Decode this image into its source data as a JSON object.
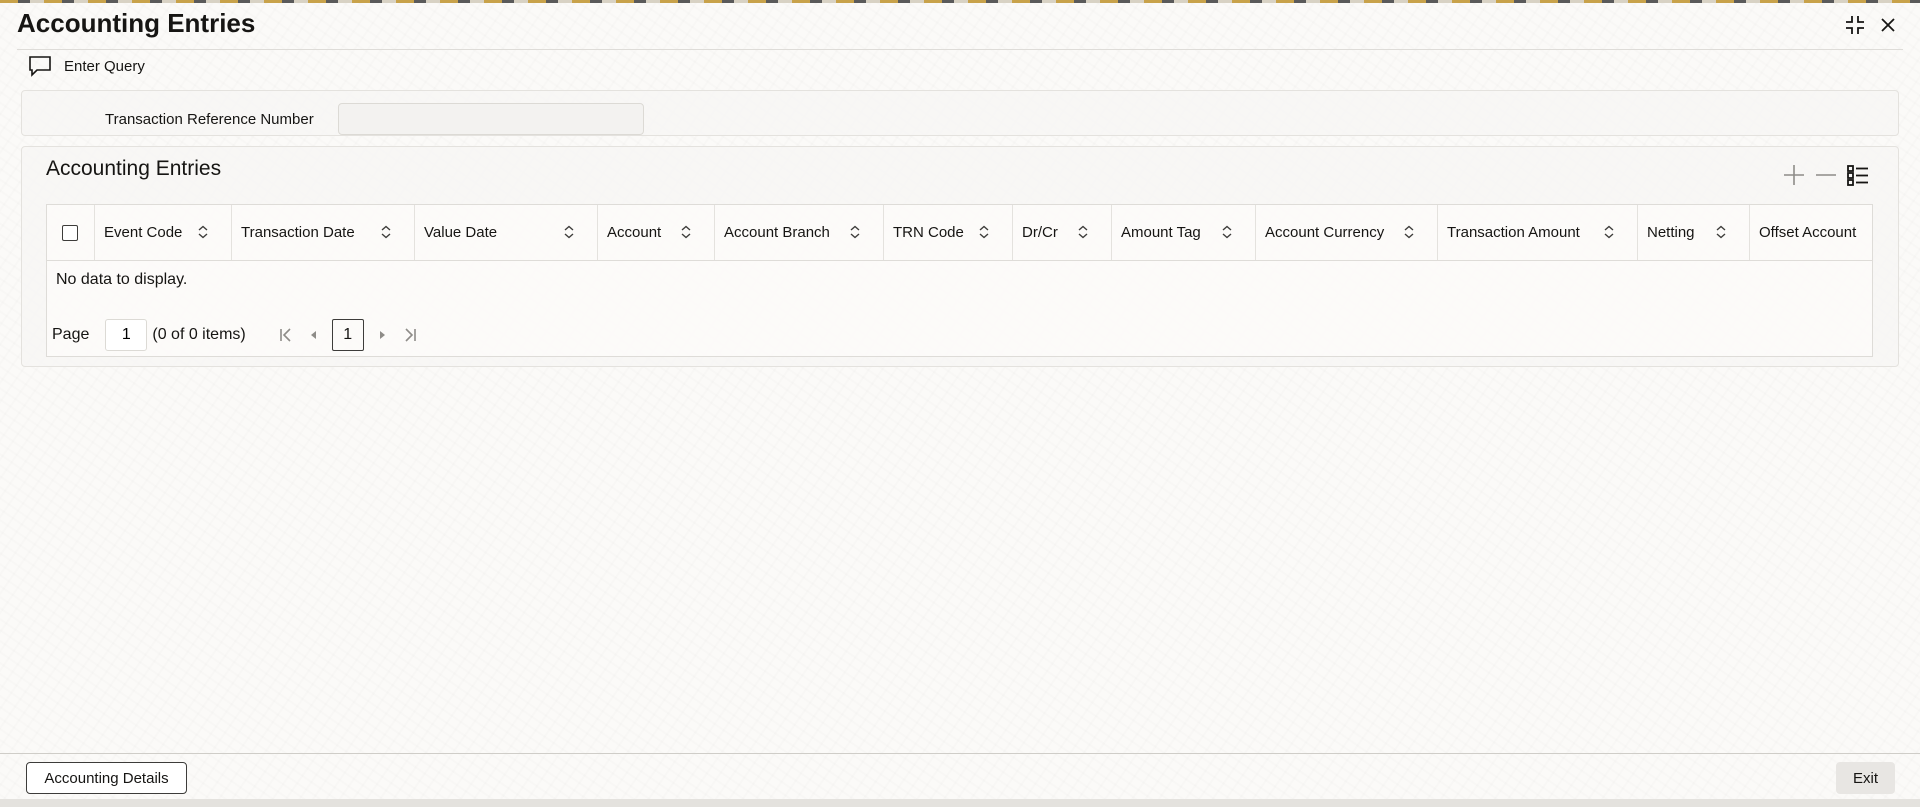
{
  "window": {
    "title": "Accounting Entries"
  },
  "toolbar": {
    "enter_query_label": "Enter Query"
  },
  "query": {
    "transaction_reference_label": "Transaction Reference Number",
    "transaction_reference_value": ""
  },
  "entries": {
    "section_title": "Accounting Entries",
    "columns": [
      "Event Code",
      "Transaction Date",
      "Value Date",
      "Account",
      "Account Branch",
      "TRN Code",
      "Dr/Cr",
      "Amount Tag",
      "Account Currency",
      "Transaction Amount",
      "Netting",
      "Offset Account"
    ],
    "rows": [],
    "empty_message": "No data to display."
  },
  "pagination": {
    "page_label": "Page",
    "page_input_value": "1",
    "items_summary": "(0 of 0 items)",
    "current_page": "1"
  },
  "footer": {
    "accounting_details_label": "Accounting Details",
    "exit_label": "Exit"
  },
  "icons": {
    "window_controls": [
      "collapse-icon",
      "close-icon"
    ],
    "toolbar": "chat-bubble-icon",
    "grid_tools": [
      "plus-icon",
      "minus-icon",
      "column-list-icon"
    ],
    "sort": "sort-updown-icon",
    "pager": [
      "first-page-icon",
      "previous-page-icon",
      "next-page-icon",
      "last-page-icon"
    ]
  },
  "colors": {
    "text": "#161513",
    "border": "#dedcd8",
    "panel": "#f7f6f4",
    "exit_button": "#e8e6e3"
  }
}
